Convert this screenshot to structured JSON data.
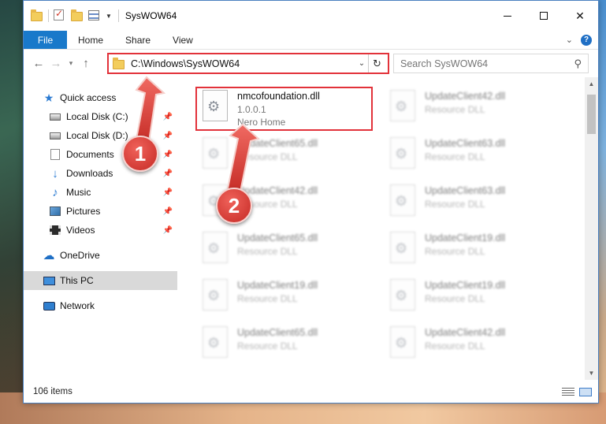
{
  "window": {
    "title": "SysWOW64"
  },
  "ribbon": {
    "file": "File",
    "tabs": [
      "Home",
      "Share",
      "View"
    ]
  },
  "address": {
    "path": "C:\\Windows\\SysWOW64"
  },
  "search": {
    "placeholder": "Search SysWOW64"
  },
  "nav": {
    "quick_access": "Quick access",
    "items": [
      {
        "label": "Local Disk (C:)",
        "icon": "drive-icon"
      },
      {
        "label": "Local Disk (D:)",
        "icon": "drive-icon"
      },
      {
        "label": "Documents",
        "icon": "documents-icon"
      },
      {
        "label": "Downloads",
        "icon": "downloads-icon"
      },
      {
        "label": "Music",
        "icon": "music-icon"
      },
      {
        "label": "Pictures",
        "icon": "pictures-icon"
      },
      {
        "label": "Videos",
        "icon": "videos-icon"
      }
    ],
    "onedrive": "OneDrive",
    "this_pc": "This PC",
    "network": "Network"
  },
  "files": {
    "highlighted": {
      "name": "nmcofoundation.dll",
      "line2": "1.0.0.1",
      "line3": "Nero Home"
    },
    "left_column": [
      {
        "name": "UpdateClient65.dll",
        "type": "Resource DLL"
      },
      {
        "name": "UpdateClient42.dll",
        "type": "Resource DLL"
      },
      {
        "name": "UpdateClient65.dll",
        "type": "Resource DLL"
      },
      {
        "name": "UpdateClient19.dll",
        "type": "Resource DLL"
      },
      {
        "name": "UpdateClient65.dll",
        "type": "Resource DLL"
      }
    ],
    "right_column": [
      {
        "name": "UpdateClient42.dll",
        "type": "Resource DLL"
      },
      {
        "name": "UpdateClient63.dll",
        "type": "Resource DLL"
      },
      {
        "name": "UpdateClient63.dll",
        "type": "Resource DLL"
      },
      {
        "name": "UpdateClient19.dll",
        "type": "Resource DLL"
      },
      {
        "name": "UpdateClient19.dll",
        "type": "Resource DLL"
      },
      {
        "name": "UpdateClient42.dll",
        "type": "Resource DLL"
      }
    ]
  },
  "status": {
    "item_count": "106 items"
  },
  "annotations": {
    "step1": "1",
    "step2": "2"
  },
  "colors": {
    "accent": "#1979ca",
    "highlight_red": "#e2323a",
    "badge_red": "#d9342c"
  }
}
